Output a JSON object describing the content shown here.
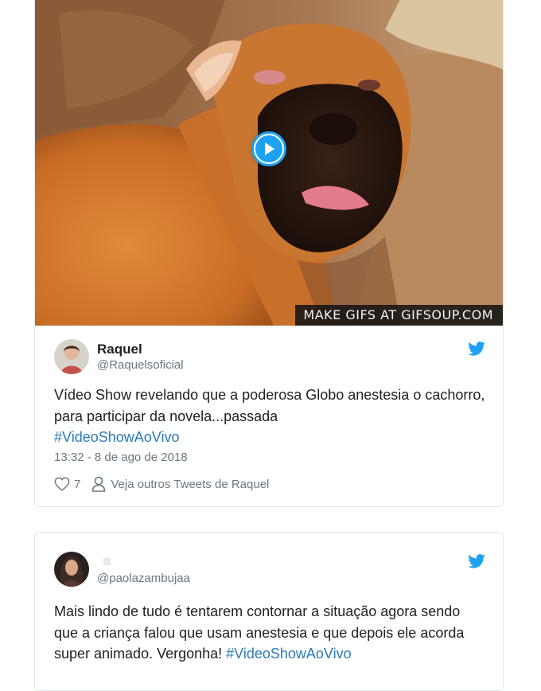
{
  "tweets": [
    {
      "media": {
        "watermark": "MAKE GIFS AT GIFSOUP.COM",
        "play_icon": "play-icon"
      },
      "display_name": "Raquel",
      "handle": "@Raquelsoficial",
      "text_main": "Vídeo Show revelando que a poderosa Globo anestesia o cachorro, para participar da novela...passada",
      "hashtag": "#VideoShowAoVivo",
      "timestamp": "13:32 - 8 de ago de 2018",
      "likes": "7",
      "see_others": "Veja outros Tweets de Raquel"
    },
    {
      "display_name": "",
      "handle": "@paolazambujaa",
      "text_main": "Mais lindo de tudo é tentarem contornar a situação agora sendo que a criança falou que usam anestesia e que depois ele acorda super animado. Vergonha! ",
      "hashtag": "#VideoShowAoVivo"
    }
  ],
  "colors": {
    "twitter_blue": "#1da1f2",
    "hashtag": "#2b7bb9",
    "muted": "#697882",
    "border": "#e1e8ed"
  },
  "icons": [
    "play-icon",
    "twitter-bird-icon",
    "heart-icon",
    "person-icon"
  ]
}
